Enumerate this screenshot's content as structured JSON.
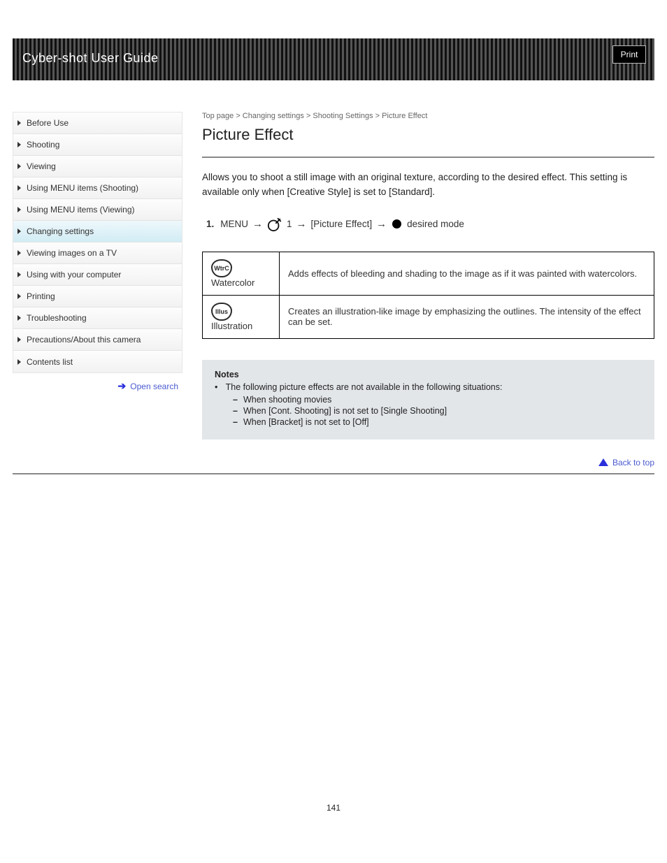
{
  "banner": {
    "title": "Cyber-shot User Guide",
    "print": "Print"
  },
  "sidebar": {
    "items": [
      {
        "label": "Before Use"
      },
      {
        "label": "Shooting"
      },
      {
        "label": "Viewing"
      },
      {
        "label": "Using MENU items (Shooting)"
      },
      {
        "label": "Using MENU items (Viewing)"
      },
      {
        "label": "Changing settings"
      },
      {
        "label": "Viewing images on a TV"
      },
      {
        "label": "Using with your computer"
      },
      {
        "label": "Printing"
      },
      {
        "label": "Troubleshooting"
      },
      {
        "label": "Precautions/About this camera"
      },
      {
        "label": "Contents list"
      }
    ],
    "activeIndex": 5,
    "openSearch": "Open search"
  },
  "content": {
    "breadcrumb": "Top page > Changing settings > Shooting Settings > Picture Effect",
    "title": "Picture Effect",
    "intro": "Allows you to shoot a still image with an original texture, according to the desired effect. This setting is available only when [Creative Style] is set to [Standard].",
    "step": {
      "num": "1.",
      "menu": "MENU",
      "arrow": "→",
      "setting1": "1",
      "setting2": "[Picture Effect]",
      "tail": "desired mode"
    },
    "table": {
      "rows": [
        {
          "badge": "WtrC",
          "label": "Watercolor",
          "desc": "Adds effects of bleeding and shading to the image as if it was painted with watercolors."
        },
        {
          "badge": "Illus",
          "label": "Illustration",
          "desc": "Creates an illustration-like image by emphasizing the outlines. The intensity of the effect can be set."
        }
      ]
    },
    "note": {
      "heading": "Notes",
      "lead": "The following picture effects are not available in the following situations:",
      "items": [
        "When shooting movies",
        "When [Cont. Shooting] is not set to [Single Shooting]",
        "When [Bracket] is not set to [Off]"
      ]
    },
    "backtop": "Back to top"
  },
  "pageNumber": "141"
}
